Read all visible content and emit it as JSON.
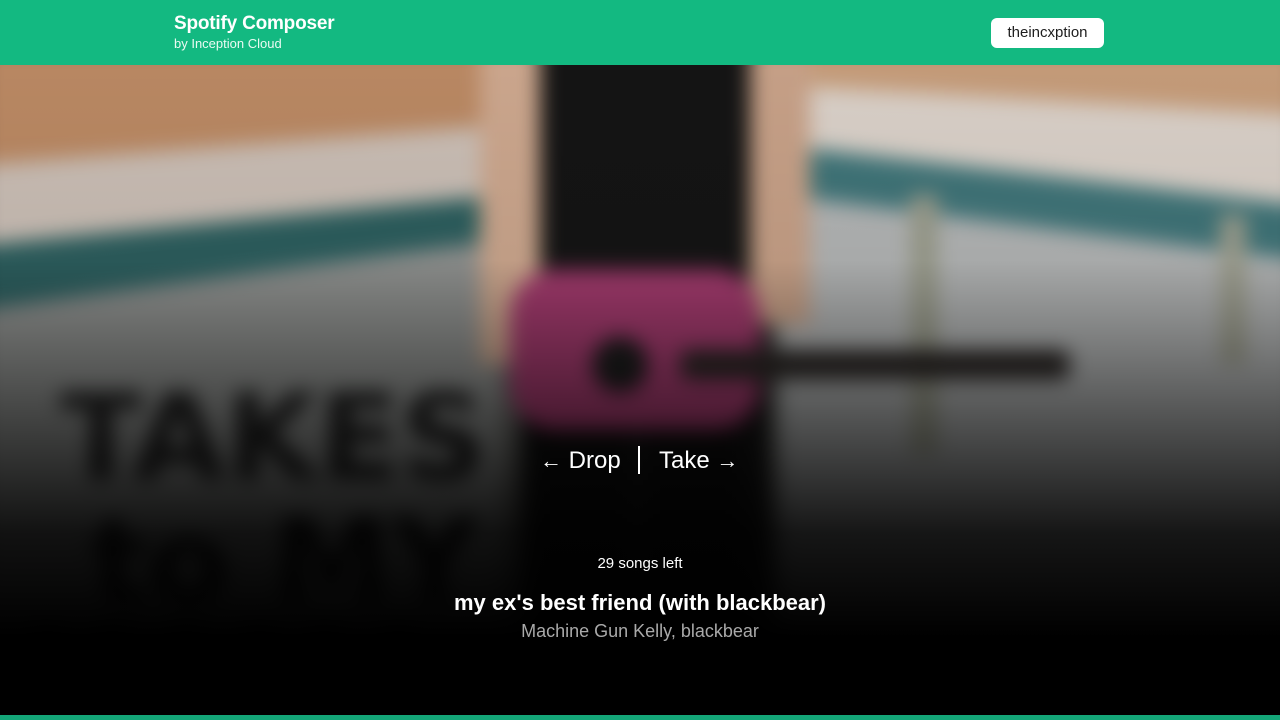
{
  "app": {
    "title": "Spotify Composer",
    "subtitle": "by Inception Cloud",
    "accent_color": "#13b981"
  },
  "user": {
    "name": "theincxption"
  },
  "controls": {
    "drop_label": "Drop",
    "drop_icon": "arrow-left-icon",
    "take_label": "Take",
    "take_icon": "arrow-right-icon"
  },
  "queue": {
    "songs_left_text": "29 songs left"
  },
  "track": {
    "title": "my ex's best friend (with blackbear)",
    "artist": "Machine Gun Kelly, blackbear"
  }
}
